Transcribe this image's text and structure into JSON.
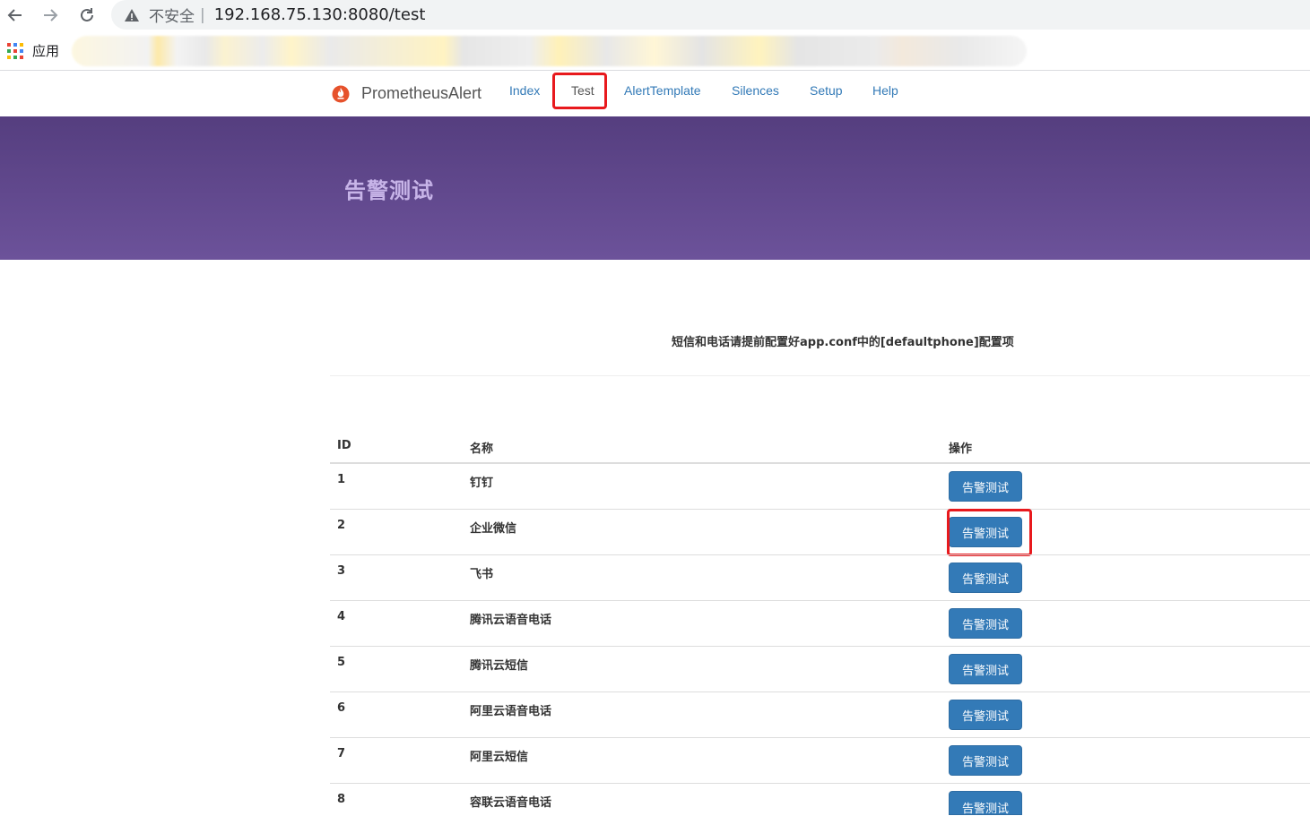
{
  "browser": {
    "insecure_label": "不安全",
    "separator": "|",
    "url": "192.168.75.130:8080/test",
    "apps_label": "应用"
  },
  "site": {
    "brand": "PrometheusAlert",
    "nav": [
      "Index",
      "Test",
      "AlertTemplate",
      "Silences",
      "Setup",
      "Help"
    ],
    "active_nav": "Test"
  },
  "hero": {
    "title": "告警测试"
  },
  "note": "短信和电话请提前配置好app.conf中的[defaultphone]配置项",
  "table": {
    "headers": [
      "ID",
      "名称",
      "操作"
    ],
    "rows": [
      {
        "id": "1",
        "name": "钉钉",
        "action": "告警测试"
      },
      {
        "id": "2",
        "name": "企业微信",
        "action": "告警测试"
      },
      {
        "id": "3",
        "name": "飞书",
        "action": "告警测试"
      },
      {
        "id": "4",
        "name": "腾讯云语音电话",
        "action": "告警测试"
      },
      {
        "id": "5",
        "name": "腾讯云短信",
        "action": "告警测试"
      },
      {
        "id": "6",
        "name": "阿里云语音电话",
        "action": "告警测试"
      },
      {
        "id": "7",
        "name": "阿里云短信",
        "action": "告警测试"
      },
      {
        "id": "8",
        "name": "容联云语音电话",
        "action": "告警测试"
      }
    ]
  },
  "colors": {
    "link": "#337ab7",
    "button": "#337ab7",
    "hero_top": "#553e7f",
    "hero_bottom": "#6c529a",
    "highlight": "#e8191d"
  }
}
